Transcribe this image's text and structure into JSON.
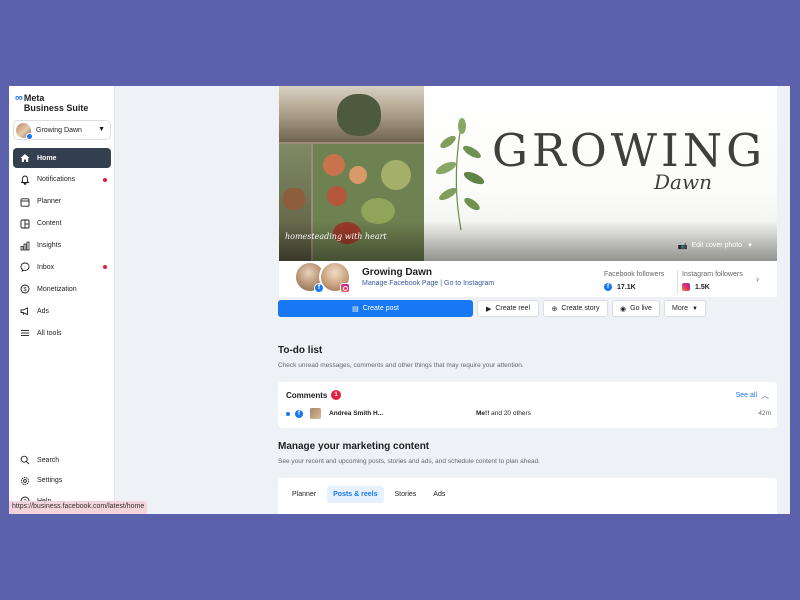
{
  "app": {
    "logo_mark": "∞",
    "logo_line1": "Meta",
    "logo_line2": "Business Suite"
  },
  "account": {
    "name": "Growing Dawn",
    "caret": "▼"
  },
  "nav": {
    "items": [
      {
        "label": "Home",
        "icon": "home-icon"
      },
      {
        "label": "Notifications",
        "icon": "bell-icon"
      },
      {
        "label": "Planner",
        "icon": "calendar-icon"
      },
      {
        "label": "Content",
        "icon": "content-icon"
      },
      {
        "label": "Insights",
        "icon": "insights-icon"
      },
      {
        "label": "Inbox",
        "icon": "chat-icon"
      },
      {
        "label": "Monetization",
        "icon": "dollar-icon"
      },
      {
        "label": "Ads",
        "icon": "megaphone-icon"
      },
      {
        "label": "All tools",
        "icon": "menu-icon"
      }
    ],
    "bottom": [
      {
        "label": "Search",
        "icon": "search-icon"
      },
      {
        "label": "Settings",
        "icon": "gear-icon"
      },
      {
        "label": "Help",
        "icon": "help-icon"
      }
    ]
  },
  "status_url": "https://business.facebook.com/latest/home",
  "cover": {
    "title": "GROWING",
    "subtitle": "Dawn",
    "tagline": "homesteading with heart",
    "edit_label": "Edit cover photo"
  },
  "page": {
    "name": "Growing Dawn",
    "link_manage": "Manage Facebook Page",
    "link_sep": "|",
    "link_instagram": "Go to Instagram",
    "fb_followers_label": "Facebook followers",
    "fb_followers_value": "17.1K",
    "ig_followers_label": "Instagram followers",
    "ig_followers_value": "1.5K"
  },
  "actions": {
    "create_post": "Create post",
    "create_reel": "Create reel",
    "create_story": "Create story",
    "go_live": "Go live",
    "more": "More"
  },
  "todo": {
    "title": "To-do list",
    "subtitle": "Check unread messages, comments and other things that may require your attention.",
    "comments_label": "Comments",
    "comments_count": "1",
    "see_all": "See all",
    "row": {
      "name": "Andrea Smith H...",
      "msg_bold": "Me!!",
      "msg_rest": " and 20 others",
      "time": "42m"
    }
  },
  "marketing": {
    "title": "Manage your marketing content",
    "subtitle": "See your recent and upcoming posts, stories and ads, and schedule content to plan ahead.",
    "tabs": [
      "Planner",
      "Posts & reels",
      "Stories",
      "Ads"
    ]
  },
  "colors": {
    "accent": "#1877f2",
    "sidebar_active": "#344050",
    "background_outer": "#5b62ab"
  }
}
